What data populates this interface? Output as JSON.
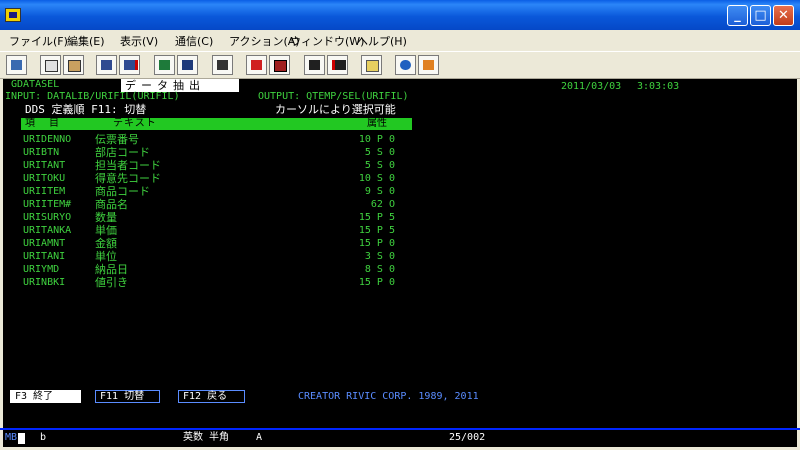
{
  "menu": [
    "ファイル(F)",
    "編集(E)",
    "表示(V)",
    "通信(C)",
    "アクション(A)",
    "ウィンドウ(W)",
    "ヘルプ(H)"
  ],
  "toolbar_icons": [
    "display-icon",
    "copy-icon",
    "paste-icon",
    "connect-icon",
    "disconnect-icon",
    "screen1-icon",
    "screen2-icon",
    "keyboard-icon",
    "record-start-icon",
    "record-stop-icon",
    "play-icon",
    "play-stop-icon",
    "clipboard-icon",
    "globe-icon",
    "tools-icon"
  ],
  "screen": {
    "program": "GDATASEL",
    "popup_title": "データ抽出",
    "date": "2011/03/03",
    "time": "3:03:03",
    "input": "INPUT:  DATALIB/URIFIL(URIFIL)",
    "output": "OUTPUT:  QTEMP/SEL(URIFIL)",
    "order": "DDS 定義順 F11: 切替",
    "cursor_hint": "カーソルにより選択可能",
    "header": {
      "item": "項 目",
      "text": "テキスト",
      "attr": "属性"
    },
    "fields": [
      {
        "name": "URIDENNO",
        "text": "伝票番号",
        "attr": "10 P  0"
      },
      {
        "name": "URIBTN",
        "text": "部店コード",
        "attr": "5 S  0"
      },
      {
        "name": "URITANT",
        "text": "担当者コード",
        "attr": "5 S  0"
      },
      {
        "name": "URITOKU",
        "text": "得意先コード",
        "attr": "10 S  0"
      },
      {
        "name": "URIITEM",
        "text": "商品コード",
        "attr": "9 S  0"
      },
      {
        "name": "URIITEM#",
        "text": "商品名",
        "attr": "62 O"
      },
      {
        "name": "URISURYO",
        "text": "数量",
        "attr": "15 P  5"
      },
      {
        "name": "URITANKA",
        "text": "単価",
        "attr": "15 P  5"
      },
      {
        "name": "URIAMNT",
        "text": "金額",
        "attr": "15 P  0"
      },
      {
        "name": "URITANI",
        "text": "単位",
        "attr": "3 S  0"
      },
      {
        "name": "URIYMD",
        "text": "納品日",
        "attr": "8 S  0"
      },
      {
        "name": "URINBKI",
        "text": "値引き",
        "attr": "15 P  0"
      }
    ],
    "fkeys": {
      "f3": "F3 終了",
      "f11": "F11 切替",
      "f12": "F12 戻る"
    },
    "copyright": "CREATOR RIVIC CORP. 1989, 2011"
  },
  "status": {
    "mode": "MB",
    "b": "b",
    "ime": "英数 半角",
    "a": "A",
    "pos": "25/002"
  }
}
